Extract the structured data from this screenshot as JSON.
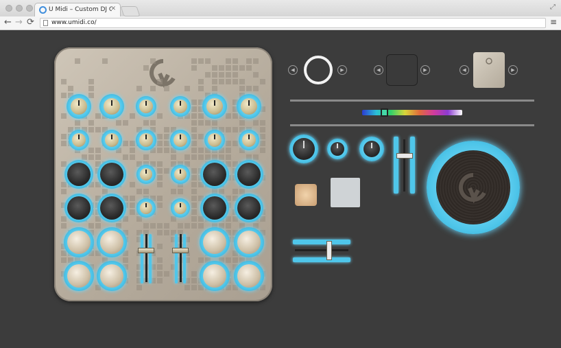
{
  "browser": {
    "tab_title": "U Midi – Custom DJ Controller",
    "tab_close": "✕",
    "url": "www.umidi.co/",
    "back_glyph": "←",
    "forward_glyph": "→",
    "reload_glyph": "⟳",
    "menu_glyph": "≡",
    "resize_glyph": "⤢"
  },
  "icons": {
    "favicon": "umidi-logo-icon",
    "page": "page-icon"
  },
  "palette": {
    "glow": "#4fc6ea",
    "controller_metal": "#c2b9ab",
    "background": "#3c3c3c"
  },
  "selectors": {
    "prev_glyph": "◀",
    "next_glyph": "▶"
  }
}
